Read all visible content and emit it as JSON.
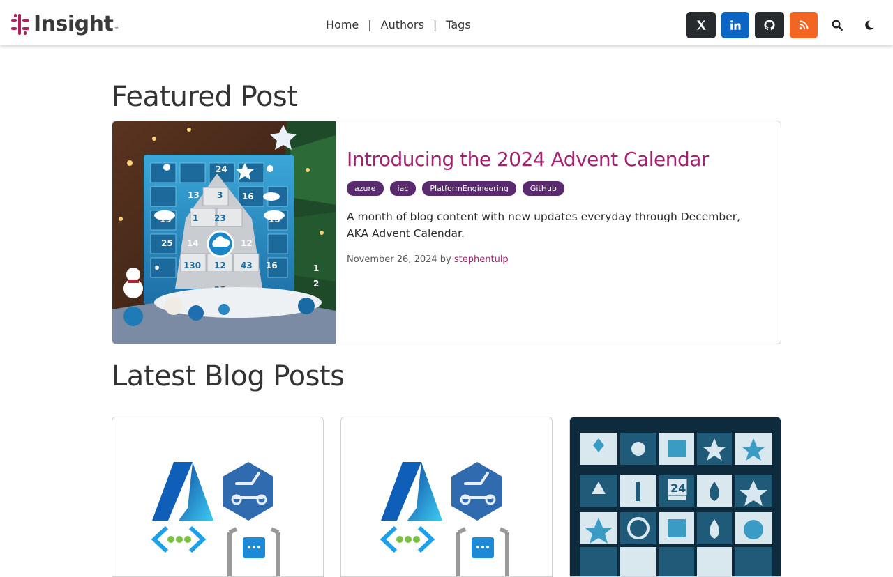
{
  "header": {
    "logo_text": "Insight",
    "logo_tm": "™",
    "nav": [
      {
        "label": "Home"
      },
      {
        "label": "Authors"
      },
      {
        "label": "Tags"
      }
    ],
    "nav_separator": "|",
    "social": [
      {
        "name": "x-twitter-icon",
        "color": "#272b30"
      },
      {
        "name": "linkedin-icon",
        "color": "#0a66c2"
      },
      {
        "name": "github-icon",
        "color": "#272b30"
      },
      {
        "name": "rss-icon",
        "color": "#f26522"
      }
    ],
    "tools": [
      "search-icon",
      "dark-mode-icon"
    ]
  },
  "featured": {
    "section_title": "Featured Post",
    "post": {
      "title": "Introducing the 2024 Advent Calendar",
      "tags": [
        "azure",
        "iac",
        "PlatformEngineering",
        "GitHub"
      ],
      "excerpt": "A month of blog content with new updates everyday through December, AKA Advent Calendar.",
      "date": "November 26, 2024",
      "by": "by",
      "author": "stephentulp",
      "image_numbers": [
        "24",
        "13",
        "3",
        "16",
        "23",
        "19",
        "1",
        "15",
        "25",
        "14",
        "12",
        "130",
        "12",
        "43",
        "16",
        "25",
        "1",
        "2"
      ]
    }
  },
  "latest": {
    "section_title": "Latest Blog Posts",
    "advent_number": "24"
  },
  "colors": {
    "accent": "#a3216f",
    "tag_bg": "#5a2a6e",
    "brand": "#b21e5b"
  }
}
